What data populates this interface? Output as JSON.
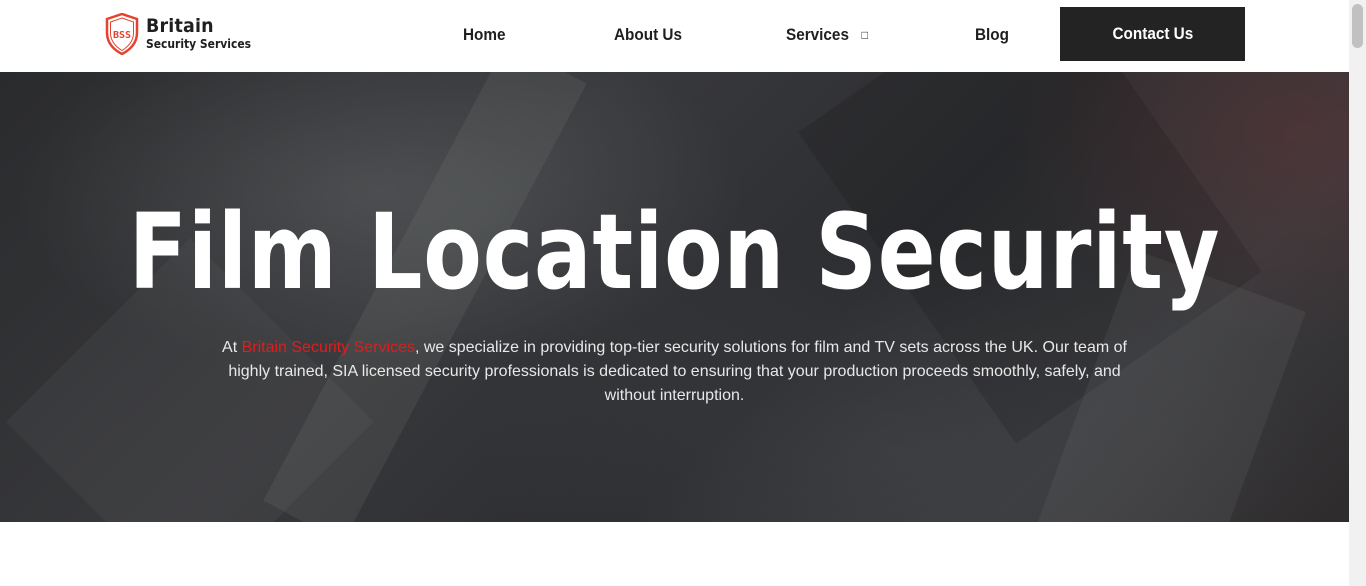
{
  "header": {
    "logo": {
      "badge_text": "BSS",
      "line1": "Britain",
      "line2": "Security Services",
      "badge_color": "#e5432f"
    },
    "nav": {
      "home": "Home",
      "about": "About Us",
      "services": "Services",
      "services_icon": "chevron-down-icon",
      "blog": "Blog"
    },
    "contact_button": "Contact Us"
  },
  "hero": {
    "title": "Film Location Security",
    "text_prefix": "At ",
    "brand_link": "Britain Security Services",
    "text_suffix": ", we specialize in providing top-tier security solutions for film and TV sets across the UK. Our team of highly trained, SIA licensed security professionals is dedicated to ensuring that your production proceeds smoothly, safely, and without interruption."
  },
  "colors": {
    "accent": "#e31b1b",
    "button_bg": "#232323",
    "text_dark": "#1f1f1f"
  }
}
